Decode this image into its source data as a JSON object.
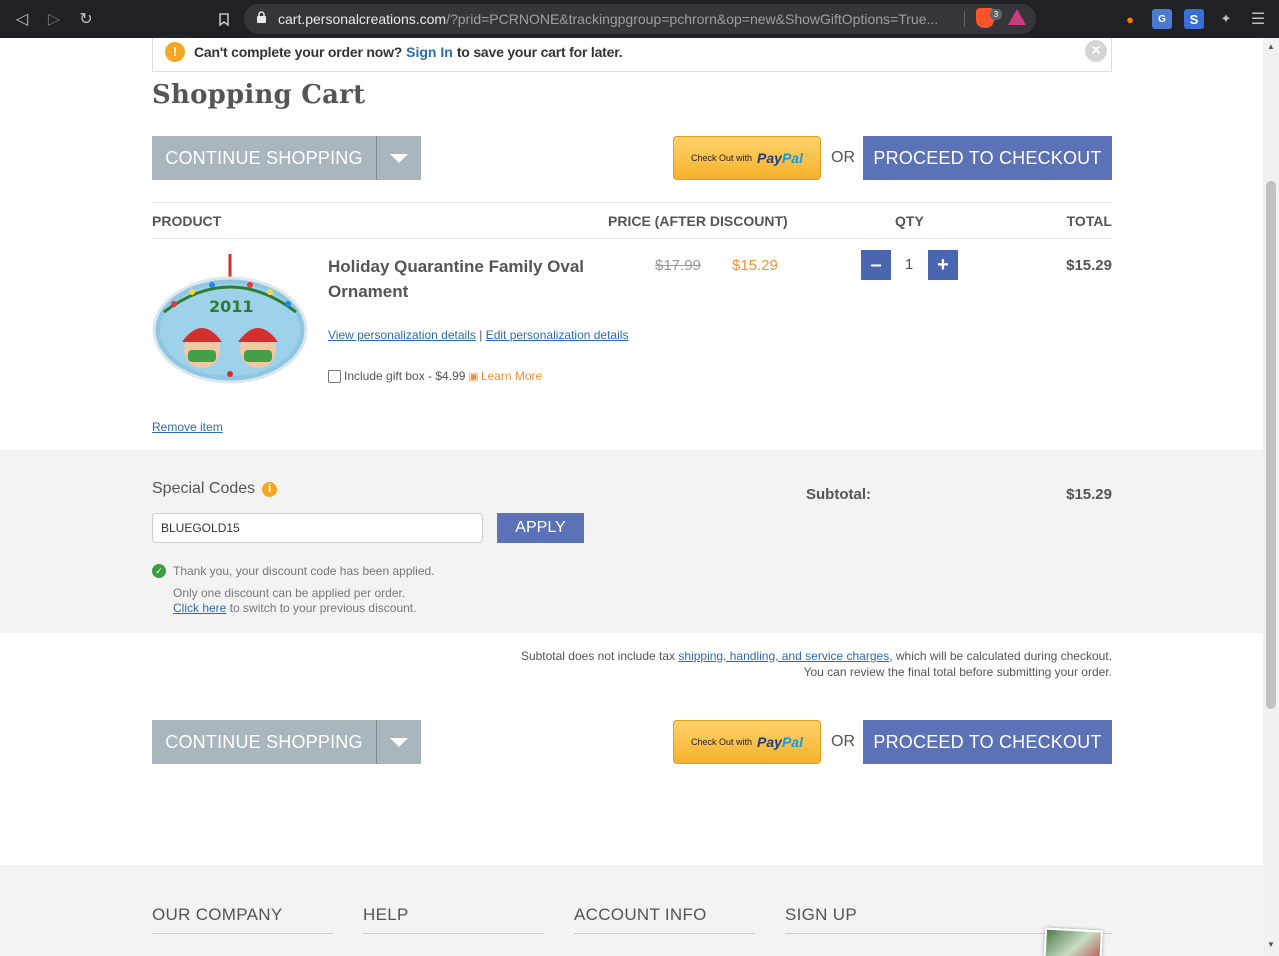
{
  "browser": {
    "url_host": "cart.personalcreations.com",
    "url_rest": "/?prid=PCRNONE&trackingpgroup=pchrorn&op=new&ShowGiftOptions=True...",
    "brave_shield_count": "3"
  },
  "alert": {
    "message": "Can't complete your order now?",
    "sign_in": "Sign In",
    "message_after": "to save your cart for later."
  },
  "page_title": "Shopping Cart",
  "buttons": {
    "continue_shopping": "CONTINUE SHOPPING",
    "paypal_small": "Check Out with",
    "paypal_brand_1": "Pay",
    "paypal_brand_2": "Pal",
    "or": "OR",
    "proceed_checkout": "PROCEED TO CHECKOUT"
  },
  "table": {
    "headers": {
      "product": "PRODUCT",
      "price": "PRICE (AFTER DISCOUNT)",
      "qty": "QTY",
      "total": "TOTAL"
    },
    "item": {
      "name": "Holiday Quarantine Family Oval Ornament",
      "price_original": "$17.99",
      "price_discounted": "$15.29",
      "qty": "1",
      "total": "$15.29",
      "view_details": "View personalization details",
      "separator": "|",
      "edit_details": "Edit personalization details",
      "gift_box_label": "Include gift box - $4.99",
      "learn_more": "Learn More",
      "ornament_year": "2011"
    },
    "remove_item": "Remove item"
  },
  "codes": {
    "title": "Special Codes",
    "input_value": "BLUEGOLD15",
    "apply": "APPLY",
    "success": "Thank you, your discount code has been applied.",
    "note_one_discount": "Only one discount can be applied per order.",
    "click_here": "Click here",
    "note_switch": "to switch to your previous discount.",
    "subtotal_label": "Subtotal:",
    "subtotal_value": "$15.29"
  },
  "tax_note": {
    "before": "Subtotal does not include tax",
    "link": "shipping, handling, and service charges",
    "after": ", which will be calculated during checkout.",
    "line2": "You can review the final total before submitting your order."
  },
  "footer": {
    "our_company": "OUR COMPANY",
    "help": "HELP",
    "account_info": "ACCOUNT INFO",
    "sign_up": "SIGN UP"
  },
  "colors": {
    "accent_blue": "#5b72b6",
    "continue_gray": "#a9b6bd",
    "price_orange": "#f0913a",
    "paypal_yellow": "#f7b12c"
  }
}
